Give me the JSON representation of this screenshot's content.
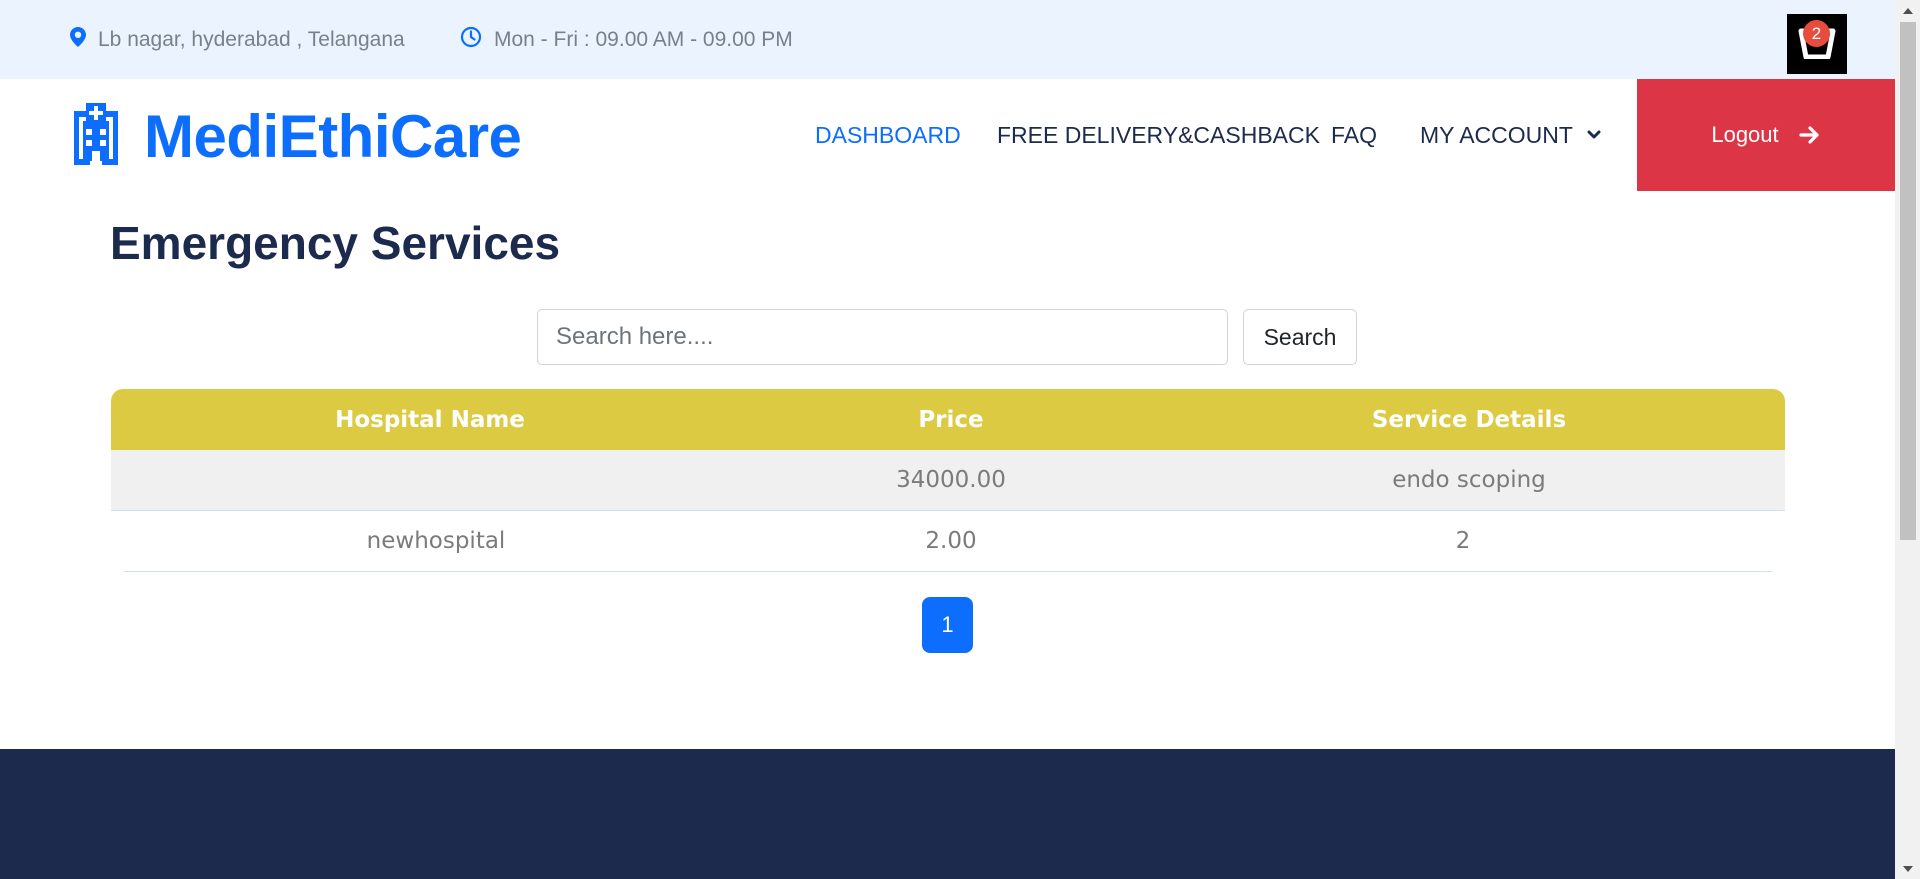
{
  "topbar": {
    "location": "Lb nagar, hyderabad , Telangana",
    "hours": "Mon - Fri : 09.00 AM - 09.00 PM",
    "cart_count": "2"
  },
  "brand": {
    "name": "MediEthiCare"
  },
  "nav": {
    "items": [
      {
        "label": "DASHBOARD",
        "active": true
      },
      {
        "label": "FREE DELIVERY&CASHBACK",
        "active": false
      },
      {
        "label": "FAQ",
        "active": false
      },
      {
        "label": "MY ACCOUNT",
        "active": false
      }
    ],
    "logout_label": "Logout"
  },
  "main": {
    "title": "Emergency Services",
    "search": {
      "placeholder": "Search here....",
      "value": "",
      "button_label": "Search"
    },
    "table": {
      "columns": [
        "Hospital Name",
        "Price",
        "Service Details"
      ],
      "rows": [
        {
          "hospital": "",
          "price": "34000.00",
          "details": "endo scoping"
        },
        {
          "hospital": "newhospital",
          "price": "2.00",
          "details": "2"
        }
      ]
    },
    "pagination": {
      "current_page": "1"
    }
  },
  "colors": {
    "brand_blue": "#0d6efd",
    "logout_red": "#dc3545",
    "table_header": "#dbca42",
    "footer_navy": "#1c2b4d",
    "topbar_bg": "#ebf4fe"
  }
}
